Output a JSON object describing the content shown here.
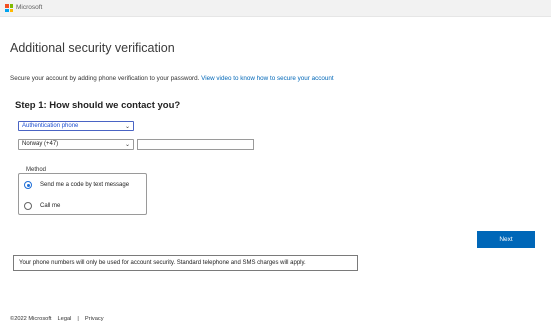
{
  "header": {
    "brand": "Microsoft",
    "logo_colors": [
      "#f25022",
      "#7fba00",
      "#00a4ef",
      "#ffb900"
    ]
  },
  "title": "Additional security verification",
  "intro": {
    "text": "Secure your account by adding phone verification to your password.",
    "link": "View video to know how to secure your account"
  },
  "step1": {
    "title": "Step 1: How should we contact you?",
    "contact_method_selected": "Authentication phone",
    "country_selected": "Norway (+47)",
    "phone_value": ""
  },
  "method": {
    "legend": "Method",
    "options": [
      {
        "label": "Send me a code by text message",
        "checked": true
      },
      {
        "label": "Call me",
        "checked": false
      }
    ]
  },
  "next_label": "Next",
  "notice": "Your phone numbers will only be used for account security. Standard telephone and SMS charges will apply.",
  "footer": {
    "copyright": "©2022 Microsoft",
    "legal": "Legal",
    "separator": "|",
    "privacy": "Privacy"
  },
  "colors": {
    "accent": "#0067b8",
    "header_bg": "#f2f2f2"
  }
}
